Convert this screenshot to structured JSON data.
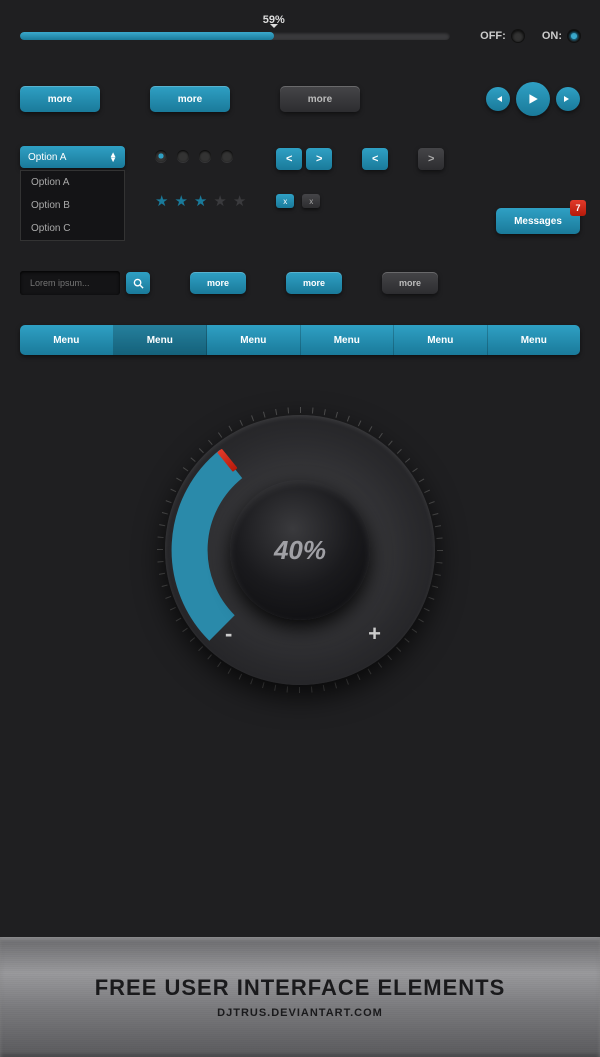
{
  "progress": {
    "percent": 59,
    "label": "59%"
  },
  "toggles": {
    "off_label": "OFF:",
    "on_label": "ON:"
  },
  "buttons": {
    "more": "more"
  },
  "dropdown": {
    "selected": "Option A",
    "options": [
      "Option A",
      "Option B",
      "Option C"
    ]
  },
  "nav": {
    "prev": "<",
    "next": ">"
  },
  "close": {
    "label": "x"
  },
  "messages": {
    "label": "Messages",
    "count": "7"
  },
  "search": {
    "placeholder": "Lorem ipsum..."
  },
  "menu": {
    "items": [
      "Menu",
      "Menu",
      "Menu",
      "Menu",
      "Menu",
      "Menu"
    ]
  },
  "dial": {
    "value": "40%",
    "minus": "-",
    "plus": "+"
  },
  "footer": {
    "title": "FREE USER INTERFACE ELEMENTS",
    "sub": "DJTRUS.DEVIANTART.COM"
  }
}
